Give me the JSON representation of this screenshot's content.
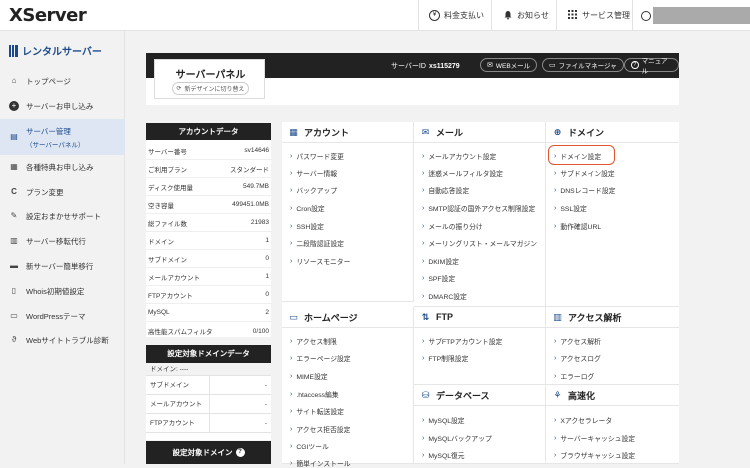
{
  "header": {
    "logo": "XServer",
    "nav": [
      {
        "label": "料金支払い",
        "icon": "yen-icon"
      },
      {
        "label": "お知らせ",
        "icon": "bell-icon"
      },
      {
        "label": "サービス管理",
        "icon": "grid-icon"
      }
    ]
  },
  "sidebar": {
    "title": "レンタルサーバー",
    "items": [
      {
        "label": "トップページ",
        "icon": "home-icon"
      },
      {
        "label": "サーバーお申し込み",
        "icon": "plus-circle-icon"
      },
      {
        "label": "サーバー管理",
        "sub": "（サーバーパネル）",
        "icon": "server-icon"
      },
      {
        "label": "各種特典お申し込み",
        "icon": "gift-icon"
      },
      {
        "label": "プラン変更",
        "icon": "refresh-icon"
      },
      {
        "label": "設定おまかせサポート",
        "icon": "wrench-icon"
      },
      {
        "label": "サーバー移転代行",
        "icon": "transfer-icon"
      },
      {
        "label": "新サーバー簡単移行",
        "icon": "truck-icon"
      },
      {
        "label": "Whois初期値設定",
        "icon": "document-icon"
      },
      {
        "label": "WordPressテーマ",
        "icon": "monitor-icon"
      },
      {
        "label": "Webサイトトラブル診断",
        "icon": "stethoscope-icon"
      }
    ]
  },
  "panel": {
    "title": "サーバーパネル",
    "switch_label": "新デザインに切り替え",
    "server_id_label": "サーバーID",
    "server_id": "xs115279",
    "buttons": [
      {
        "label": "WEBメール",
        "icon": "mail-icon"
      },
      {
        "label": "ファイルマネージャ",
        "icon": "folder-icon"
      },
      {
        "label": "マニュアル",
        "icon": "help-icon"
      }
    ]
  },
  "account": {
    "title": "アカウントデータ",
    "rows": [
      {
        "key": "サーバー番号",
        "value": "sv14646"
      },
      {
        "key": "ご利用プラン",
        "value": "スタンダード"
      },
      {
        "key": "ディスク使用量",
        "value": "549.7MB"
      },
      {
        "key": "空き容量",
        "value": "499451.0MB"
      },
      {
        "key": "総ファイル数",
        "value": "21983"
      },
      {
        "key": "ドメイン",
        "value": "1"
      },
      {
        "key": "サブドメイン",
        "value": "0"
      },
      {
        "key": "メールアカウント",
        "value": "1"
      },
      {
        "key": "FTPアカウント",
        "value": "0"
      },
      {
        "key": "MySQL",
        "value": "2"
      },
      {
        "key": "高性能スパムフィルタ",
        "value": "0/100"
      }
    ]
  },
  "domain_data": {
    "title": "設定対象ドメインデータ",
    "top": "ドメイン: ----",
    "rows": [
      {
        "key": "サブドメイン",
        "value": "-"
      },
      {
        "key": "メールアカウント",
        "value": "-"
      },
      {
        "key": "FTPアカウント",
        "value": "-"
      }
    ],
    "next_title": "設定対象ドメイン",
    "next_help": "?"
  },
  "sections": {
    "account": {
      "title": "アカウント",
      "links": [
        "パスワード変更",
        "サーバー情報",
        "バックアップ",
        "Cron設定",
        "SSH設定",
        "二段階認証設定",
        "リソースモニター"
      ]
    },
    "mail": {
      "title": "メール",
      "links": [
        "メールアカウント設定",
        "迷惑メールフィルタ設定",
        "自動応答設定",
        "SMTP認証の国外アクセス制限設定",
        "メールの振り分け",
        "メーリングリスト・メールマガジン",
        "DKIM設定",
        "SPF設定",
        "DMARC設定"
      ]
    },
    "domain": {
      "title": "ドメイン",
      "links": [
        "ドメイン設定",
        "サブドメイン設定",
        "DNSレコード設定",
        "SSL設定",
        "動作確認URL"
      ]
    },
    "homepage": {
      "title": "ホームページ",
      "links": [
        "アクセス制限",
        "エラーページ設定",
        "MIME設定",
        ".htaccess編集",
        "サイト転送設定",
        "アクセス拒否設定",
        "CGIツール",
        "簡単インストール"
      ]
    },
    "ftp": {
      "title": "FTP",
      "links": [
        "サブFTPアカウント設定",
        "FTP制限設定"
      ]
    },
    "analytics": {
      "title": "アクセス解析",
      "links": [
        "アクセス解析",
        "アクセスログ",
        "エラーログ"
      ]
    },
    "database": {
      "title": "データベース",
      "links": [
        "MySQL設定",
        "MySQLバックアップ",
        "MySQL復元"
      ]
    },
    "speed": {
      "title": "高速化",
      "links": [
        "Xアクセラレータ",
        "サーバーキャッシュ設定",
        "ブラウザキャッシュ設定"
      ]
    }
  }
}
